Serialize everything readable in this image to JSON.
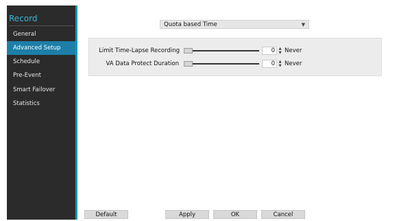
{
  "sidebar": {
    "title": "Record",
    "items": [
      {
        "label": "General",
        "active": false
      },
      {
        "label": "Advanced Setup",
        "active": true
      },
      {
        "label": "Schedule",
        "active": false
      },
      {
        "label": "Pre-Event",
        "active": false
      },
      {
        "label": "Smart Failover",
        "active": false
      },
      {
        "label": "Statistics",
        "active": false
      }
    ]
  },
  "mode_select": {
    "value": "Quota based Time"
  },
  "settings": [
    {
      "label": "Limit Time-Lapse Recording",
      "value": "0",
      "unit": "Never",
      "slider_level": 0
    },
    {
      "label": "VA Data Protect Duration",
      "value": "0",
      "unit": "Never",
      "slider_level": 0
    }
  ],
  "buttons": {
    "default": "Default",
    "apply": "Apply",
    "ok": "OK",
    "cancel": "Cancel"
  },
  "colors": {
    "sidebar_bg": "#2b2b2b",
    "accent": "#1c9bb8",
    "active_item": "#1d7fa8",
    "title": "#38b7d4"
  }
}
